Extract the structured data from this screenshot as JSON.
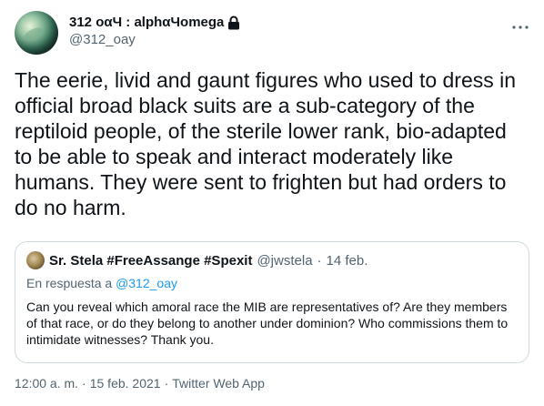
{
  "author": {
    "display_name": "312 οαЧ : alphαЧomega",
    "handle": "@312_oay",
    "avatar_icon": "planet-avatar",
    "protected_icon": "lock-icon"
  },
  "tweet": {
    "text": "The eerie, livid and gaunt figures who used to dress in official broad black suits are a sub-category of the reptiloid people, of the sterile lower rank, bio-adapted to be able to speak and interact moderately like humans. They were sent to frighten but had orders to do no harm."
  },
  "quoted": {
    "display_name": "Sr. Stela #FreeAssange #Spexit",
    "handle": "@jwstela",
    "separator": "·",
    "date": "14 feb.",
    "reply_prefix": "En respuesta a",
    "reply_to": "@312_oay",
    "text": "Can you reveal which amoral race the MIB are representatives of? Are they members of that race, or do they belong to another under dominion? Who commissions them to intimidate witnesses? Thank you."
  },
  "meta": {
    "time": "12:00 a. m.",
    "sep1": "·",
    "date": "15 feb. 2021",
    "sep2": "·",
    "source": "Twitter Web App"
  },
  "colors": {
    "text": "#0f1419",
    "secondary": "#536471",
    "link": "#1d9bf0",
    "border": "#cfd9de"
  }
}
